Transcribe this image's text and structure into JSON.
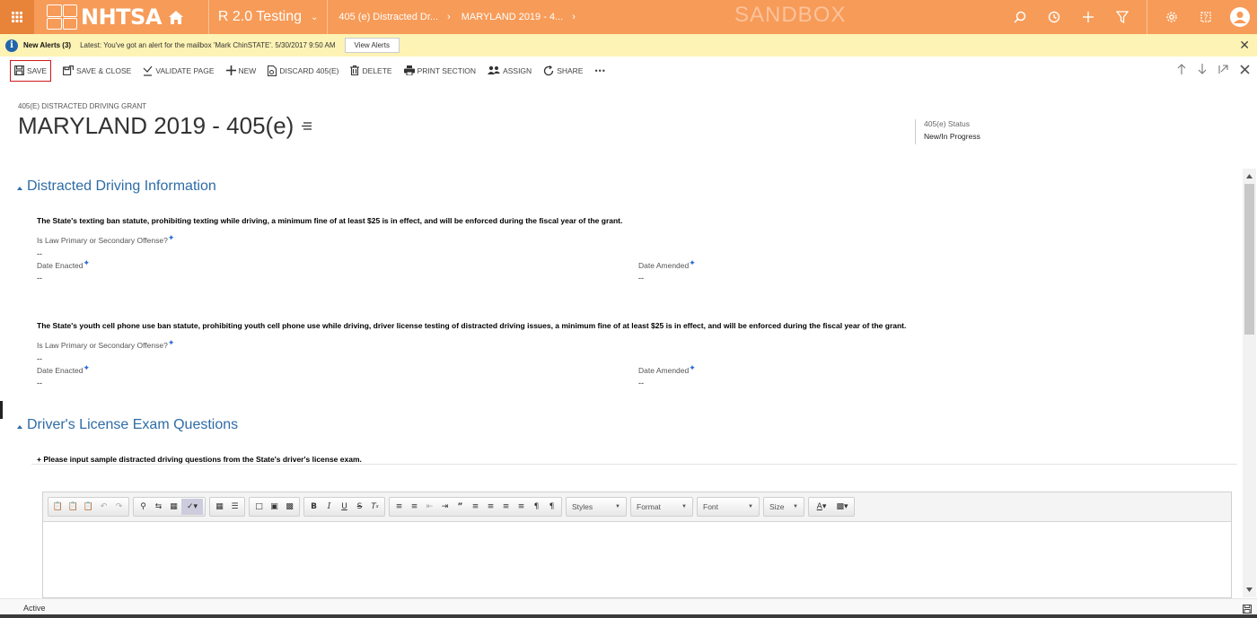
{
  "topbar": {
    "logo_text": "NHTSA",
    "app_name": "R 2.0 Testing",
    "crumbs": [
      "405 (e) Distracted Dr...",
      "MARYLAND 2019 - 4..."
    ],
    "environment": "SANDBOX",
    "icons": [
      "search-icon",
      "recent-icon",
      "new-icon",
      "filter-icon",
      "settings-icon",
      "help-icon",
      "user-icon"
    ]
  },
  "alert": {
    "title": "New Alerts (3)",
    "message": "Latest: You've got an alert for the mailbox 'Mark ChinSTATE'. 5/30/2017 9:50 AM",
    "button": "View Alerts"
  },
  "commands": {
    "save": "SAVE",
    "save_close": "SAVE & CLOSE",
    "validate": "VALIDATE PAGE",
    "new": "NEW",
    "discard": "DISCARD 405(E)",
    "delete": "DELETE",
    "print": "PRINT SECTION",
    "assign": "ASSIGN",
    "share": "SHARE",
    "more": "•••"
  },
  "record": {
    "entity": "405(E) DISTRACTED DRIVING GRANT",
    "title": "MARYLAND 2019 - 405(e)",
    "status_label": "405(e) Status",
    "status_value": "New/In Progress"
  },
  "sections": {
    "distracted": {
      "title": "Distracted Driving Information",
      "texting": {
        "statement": "The State's texting ban statute, prohibiting texting while driving, a minimum fine of at least $25 is in effect, and will be enforced during the fiscal year of the grant.",
        "offense_label": "Is Law Primary or Secondary Offense?",
        "offense_value": "--",
        "enacted_label": "Date Enacted",
        "enacted_value": "--",
        "amended_label": "Date Amended",
        "amended_value": "--"
      },
      "youth": {
        "statement": "The State's youth cell phone use ban statute, prohibiting youth cell phone use while driving, driver license testing of distracted driving issues, a minimum fine of at least $25 is in effect, and will be enforced during the fiscal year of the grant.",
        "offense_label": "Is Law Primary or Secondary Offense?",
        "offense_value": "--",
        "enacted_label": "Date Enacted",
        "enacted_value": "--",
        "amended_label": "Date Amended",
        "amended_value": "--"
      }
    },
    "exam": {
      "title": "Driver's License Exam Questions",
      "instruction": "+ Please input sample distracted driving questions from the State's driver's license exam."
    }
  },
  "editor": {
    "styles": "Styles",
    "format": "Format",
    "font": "Font",
    "size": "Size"
  },
  "footer": {
    "status": "Active"
  }
}
